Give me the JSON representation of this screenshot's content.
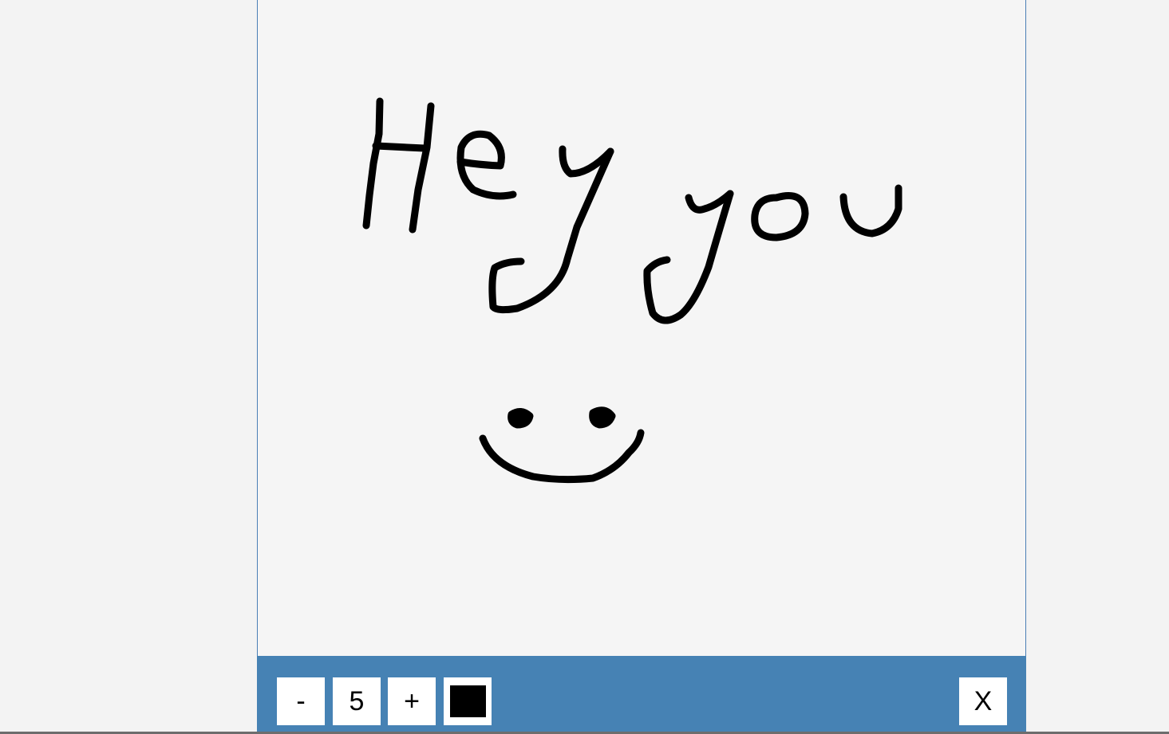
{
  "toolbar": {
    "decrease_label": "-",
    "brush_size": "5",
    "increase_label": "+",
    "close_label": "X",
    "current_color": "#000000",
    "background_color": "#4682b4"
  },
  "canvas": {
    "background_color": "#f5f5f5",
    "stroke_color": "#000000"
  }
}
